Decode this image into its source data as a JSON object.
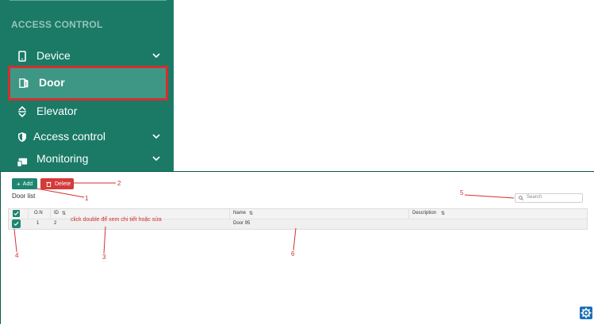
{
  "sidebar": {
    "header": "ACCESS CONTROL",
    "items": [
      {
        "label": "Device",
        "icon": "device-icon",
        "expandable": true
      },
      {
        "label": "Door",
        "icon": "door-icon",
        "active": true
      },
      {
        "label": "Elevator",
        "icon": "elevator-icon"
      },
      {
        "label": "Access control",
        "icon": "shield-icon",
        "expandable": true
      },
      {
        "label": "Monitoring",
        "icon": "monitor-icon",
        "expandable": true
      }
    ]
  },
  "toolbar": {
    "add_label": "Add",
    "delete_label": "Delete"
  },
  "page": {
    "title": "Door list"
  },
  "search": {
    "placeholder": "Search"
  },
  "table": {
    "columns": [
      "O.N",
      "ID",
      "Name",
      "Description"
    ],
    "rows": [
      {
        "on": "1",
        "id": "2",
        "name": "Door 95",
        "description": ""
      }
    ]
  },
  "hint_text": "click double để xem chi tiết hoặc sửa",
  "annotations": [
    "1",
    "2",
    "3",
    "4",
    "5",
    "6"
  ],
  "colors": {
    "sidebar_bg": "#1a7a66",
    "accent": "#1e8670",
    "danger": "#d33a3a",
    "annotation": "#d32f2f"
  }
}
